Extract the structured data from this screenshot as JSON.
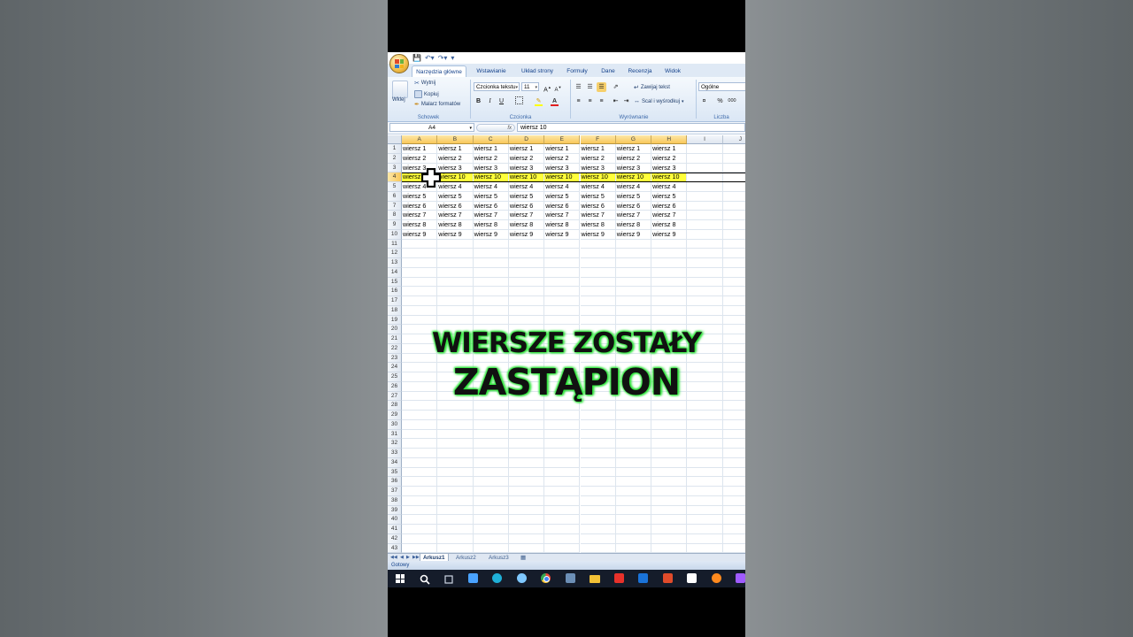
{
  "window": {
    "tabs": [
      {
        "label": "Narzędzia główne",
        "active": true
      },
      {
        "label": "Wstawianie"
      },
      {
        "label": "Układ strony"
      },
      {
        "label": "Formuły"
      },
      {
        "label": "Dane"
      },
      {
        "label": "Recenzja"
      },
      {
        "label": "Widok"
      }
    ]
  },
  "ribbon": {
    "clipboard": {
      "paste_label": "Wklej",
      "cut_label": "Wytnij",
      "copy_label": "Kopiuj",
      "format_painter_label": "Malarz formatów",
      "group_label": "Schowek"
    },
    "font": {
      "font_name": "Czcionka tekstu",
      "font_size": "11",
      "bold": "B",
      "italic": "I",
      "underline": "U",
      "group_label": "Czcionka"
    },
    "alignment": {
      "wrap_text_label": "Zawijaj tekst",
      "merge_label": "Scal i wyśrodkuj",
      "group_label": "Wyrównanie"
    },
    "number": {
      "format_value": "Ogólne",
      "percent": "%",
      "thousands": "000",
      "group_label": "Liczba"
    }
  },
  "formula_bar": {
    "name_box": "A4",
    "fx": "fx",
    "content": "wiersz 10"
  },
  "columns": [
    "A",
    "B",
    "C",
    "D",
    "E",
    "F",
    "G",
    "H",
    "I",
    "J"
  ],
  "rows": [
    {
      "num": "1",
      "cells": [
        "wiersz 1",
        "wiersz 1",
        "wiersz 1",
        "wiersz 1",
        "wiersz 1",
        "wiersz 1",
        "wiersz 1",
        "wiersz 1"
      ]
    },
    {
      "num": "2",
      "cells": [
        "wiersz 2",
        "wiersz 2",
        "wiersz 2",
        "wiersz 2",
        "wiersz 2",
        "wiersz 2",
        "wiersz 2",
        "wiersz 2"
      ]
    },
    {
      "num": "3",
      "cells": [
        "wiersz 3",
        "wiersz 3",
        "wiersz 3",
        "wiersz 3",
        "wiersz 3",
        "wiersz 3",
        "wiersz 3",
        "wiersz 3"
      ]
    },
    {
      "num": "4",
      "cells": [
        "wiersz 10",
        "wiersz 10",
        "wiersz 10",
        "wiersz 10",
        "wiersz 10",
        "wiersz 10",
        "wiersz 10",
        "wiersz 10"
      ],
      "highlight": true
    },
    {
      "num": "5",
      "cells": [
        "wiersz 4",
        "wiersz 4",
        "wiersz 4",
        "wiersz 4",
        "wiersz 4",
        "wiersz 4",
        "wiersz 4",
        "wiersz 4"
      ]
    },
    {
      "num": "6",
      "cells": [
        "wiersz 5",
        "wiersz 5",
        "wiersz 5",
        "wiersz 5",
        "wiersz 5",
        "wiersz 5",
        "wiersz 5",
        "wiersz 5"
      ]
    },
    {
      "num": "7",
      "cells": [
        "wiersz 6",
        "wiersz 6",
        "wiersz 6",
        "wiersz 6",
        "wiersz 6",
        "wiersz 6",
        "wiersz 6",
        "wiersz 6"
      ]
    },
    {
      "num": "8",
      "cells": [
        "wiersz 7",
        "wiersz 7",
        "wiersz 7",
        "wiersz 7",
        "wiersz 7",
        "wiersz 7",
        "wiersz 7",
        "wiersz 7"
      ]
    },
    {
      "num": "9",
      "cells": [
        "wiersz 8",
        "wiersz 8",
        "wiersz 8",
        "wiersz 8",
        "wiersz 8",
        "wiersz 8",
        "wiersz 8",
        "wiersz 8"
      ]
    },
    {
      "num": "10",
      "cells": [
        "wiersz 9",
        "wiersz 9",
        "wiersz 9",
        "wiersz 9",
        "wiersz 9",
        "wiersz 9",
        "wiersz 9",
        "wiersz 9"
      ]
    },
    {
      "num": "11",
      "cells": []
    },
    {
      "num": "12",
      "cells": []
    },
    {
      "num": "13",
      "cells": []
    },
    {
      "num": "14",
      "cells": []
    },
    {
      "num": "15",
      "cells": []
    },
    {
      "num": "16",
      "cells": []
    },
    {
      "num": "17",
      "cells": []
    },
    {
      "num": "18",
      "cells": []
    },
    {
      "num": "19",
      "cells": []
    },
    {
      "num": "20",
      "cells": []
    },
    {
      "num": "21",
      "cells": []
    },
    {
      "num": "22",
      "cells": []
    },
    {
      "num": "23",
      "cells": []
    },
    {
      "num": "24",
      "cells": []
    },
    {
      "num": "25",
      "cells": []
    },
    {
      "num": "26",
      "cells": []
    },
    {
      "num": "27",
      "cells": []
    },
    {
      "num": "28",
      "cells": []
    },
    {
      "num": "29",
      "cells": []
    },
    {
      "num": "30",
      "cells": []
    },
    {
      "num": "31",
      "cells": []
    },
    {
      "num": "32",
      "cells": []
    },
    {
      "num": "33",
      "cells": []
    },
    {
      "num": "34",
      "cells": []
    },
    {
      "num": "35",
      "cells": []
    },
    {
      "num": "36",
      "cells": []
    },
    {
      "num": "37",
      "cells": []
    },
    {
      "num": "38",
      "cells": []
    },
    {
      "num": "39",
      "cells": []
    },
    {
      "num": "40",
      "cells": []
    },
    {
      "num": "41",
      "cells": []
    },
    {
      "num": "42",
      "cells": []
    },
    {
      "num": "43",
      "cells": []
    }
  ],
  "overlay": {
    "line1": "WIERSZE ZOSTAŁY",
    "line2": "ZASTĄPION"
  },
  "sheets": [
    {
      "label": "Arkusz1",
      "active": true
    },
    {
      "label": "Arkusz2"
    },
    {
      "label": "Arkusz3"
    }
  ],
  "status": {
    "text": "Gotowy"
  },
  "taskbar": {
    "icons": [
      "windows-start-icon",
      "search-icon",
      "task-view-icon",
      "file-manager-icon",
      "edge-icon",
      "app-icon",
      "chrome-icon",
      "calculator-icon",
      "folder-icon",
      "red-app-icon",
      "outlook-icon",
      "word-icon",
      "capcut-icon",
      "firefox-icon",
      "other-app-icon"
    ]
  },
  "colors": {
    "highlight": "#ffff3a",
    "caption_glow": "#2ee83a",
    "selected_header": "#f9c85a"
  }
}
